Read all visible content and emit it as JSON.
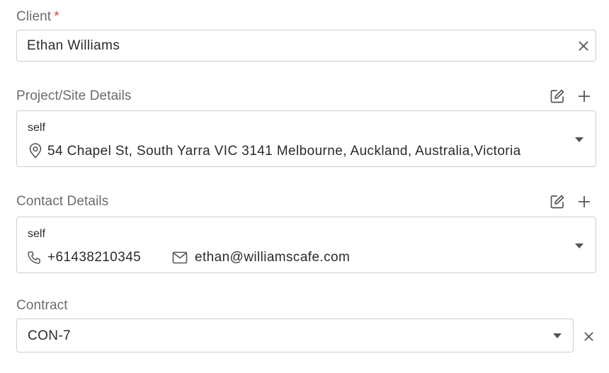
{
  "client": {
    "label": "Client",
    "required_mark": "*",
    "value": "Ethan Williams"
  },
  "project": {
    "label": "Project/Site Details",
    "name": "self",
    "address": "54 Chapel St, South Yarra VIC 3141 Melbourne, Auckland, Australia,Victoria"
  },
  "contact": {
    "label": "Contact Details",
    "name": "self",
    "phone": "+61438210345",
    "email": "ethan@williamscafe.com"
  },
  "contract": {
    "label": "Contract",
    "value": "CON-7"
  },
  "colors": {
    "required": "#e04545",
    "label": "#6b6b6b",
    "border": "#cfcfcf"
  }
}
